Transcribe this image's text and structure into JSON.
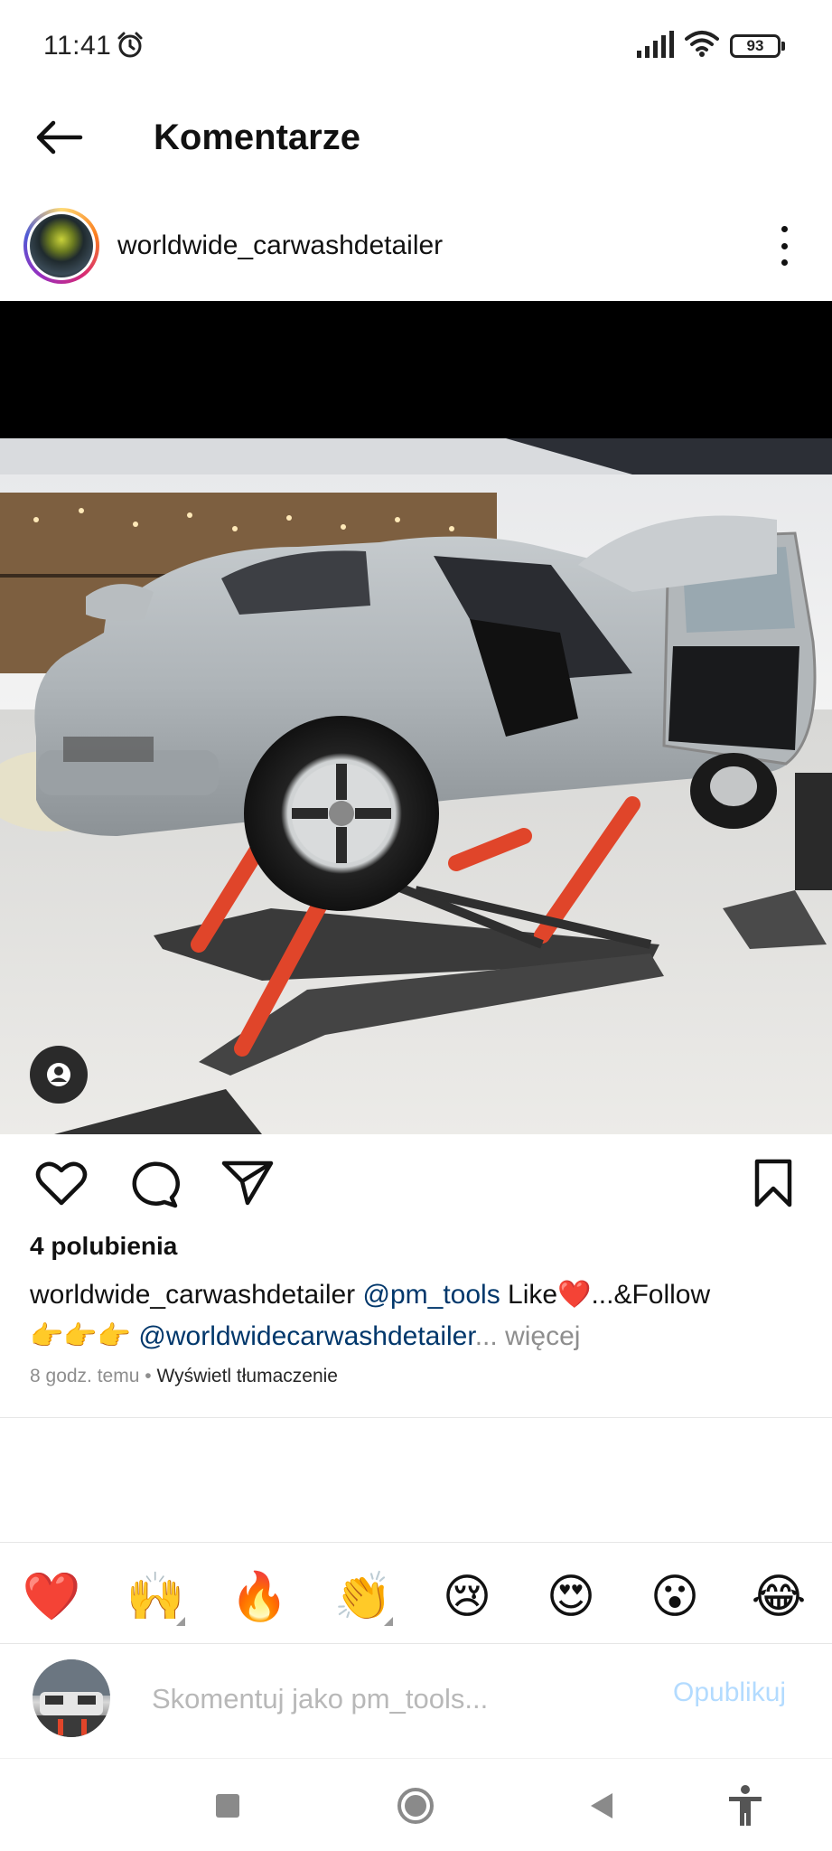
{
  "status_bar": {
    "time": "11:41",
    "battery": "93",
    "icons": [
      "alarm-icon",
      "signal-icon",
      "wifi-icon",
      "battery-icon"
    ]
  },
  "header": {
    "back_icon": "arrow-left-icon",
    "title": "Komentarze"
  },
  "post": {
    "author": "worldwide_carwashdetailer",
    "more_icon": "more-vertical-icon",
    "photo_subject": "grey-porsche-911-on-red-scissor-lift",
    "tag_icon": "user-tag-icon",
    "actions": [
      "heart-icon",
      "comment-icon",
      "share-icon",
      "bookmark-icon"
    ],
    "likes": "4 polubienia",
    "caption": {
      "user": "worldwide_carwashdetailer",
      "mention1": "@pm_tools",
      "text1": " Like",
      "heart": "❤️",
      "text2": "...&Follow",
      "pointing": "👉👉👉",
      "mention2": "@worldwidecarwashdetailer",
      "ellipsis": "...",
      "more": "więcej"
    },
    "time_ago": "8 godz. temu",
    "separator": "•",
    "translate": "Wyświetl tłumaczenie"
  },
  "reactions": [
    "❤️",
    "🙌",
    "🔥",
    "👏",
    "😢",
    "😍",
    "😮",
    "😂"
  ],
  "comment_bar": {
    "placeholder": "Skomentuj jako pm_tools...",
    "publish": "Opublikuj"
  },
  "nav_bar": [
    "recents-square-icon",
    "home-circle-icon",
    "back-triangle-icon",
    "accessibility-icon"
  ],
  "colors": {
    "mention": "#00376b",
    "muted": "#8e8e8e",
    "publish_disabled": "#b3dbff",
    "lift_red": "#e0452a"
  }
}
